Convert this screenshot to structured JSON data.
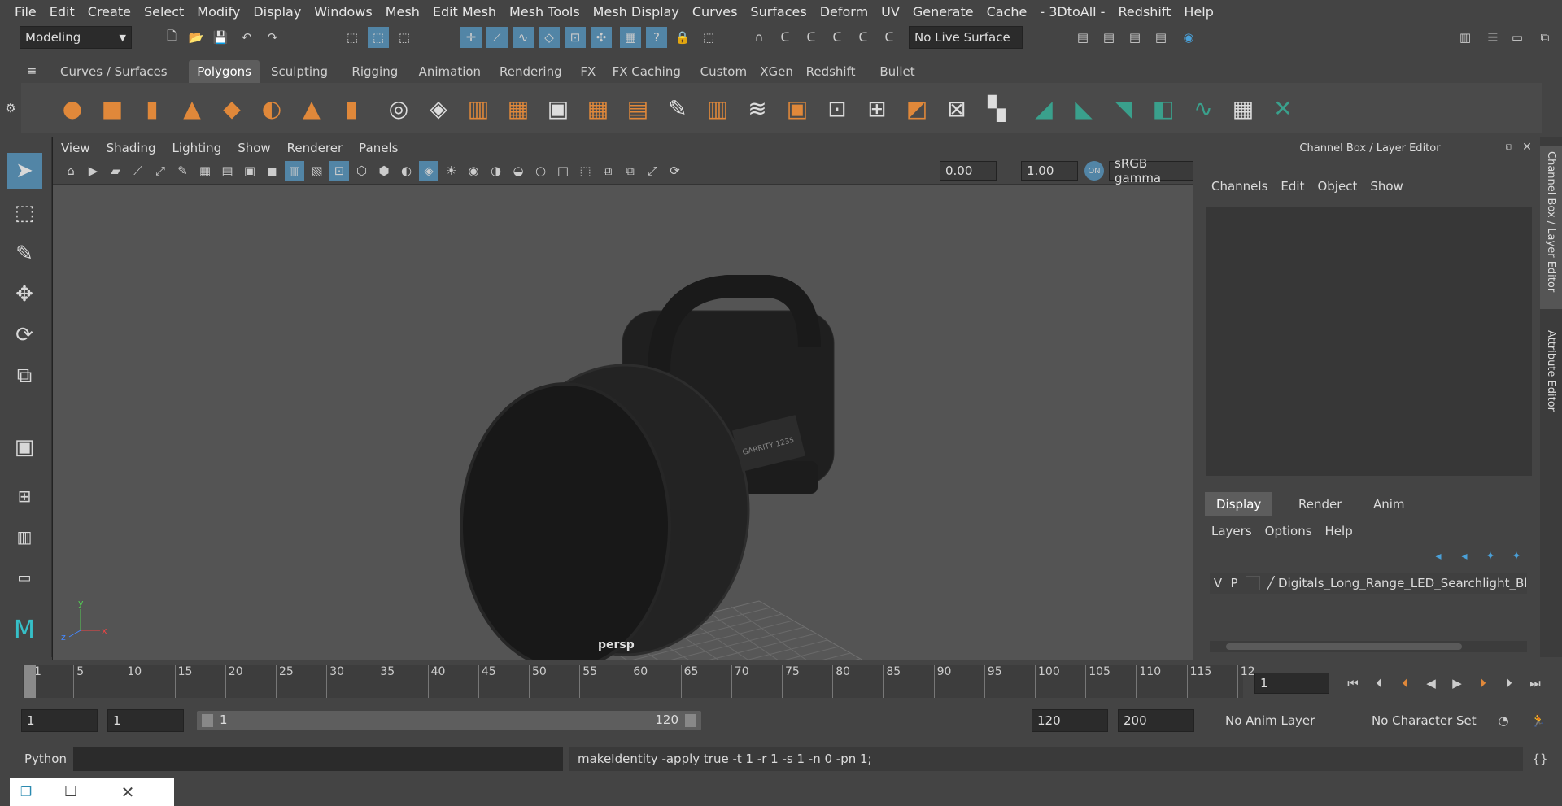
{
  "menu": [
    "File",
    "Edit",
    "Create",
    "Select",
    "Modify",
    "Display",
    "Windows",
    "Mesh",
    "Edit Mesh",
    "Mesh Tools",
    "Mesh Display",
    "Curves",
    "Surfaces",
    "Deform",
    "UV",
    "Generate",
    "Cache",
    "- 3DtoAll -",
    "Redshift",
    "Help"
  ],
  "status": {
    "mode": "Modeling",
    "live_surface": "No Live Surface"
  },
  "shelf_tabs": [
    "Curves / Surfaces",
    "Polygons",
    "Sculpting",
    "Rigging",
    "Animation",
    "Rendering",
    "FX",
    "FX Caching",
    "Custom",
    "XGen",
    "Redshift",
    "Bullet"
  ],
  "shelf_active": "Polygons",
  "viewport": {
    "menu": [
      "View",
      "Shading",
      "Lighting",
      "Show",
      "Renderer",
      "Panels"
    ],
    "exposure": "0.00",
    "gamma": "1.00",
    "color_space": "sRGB gamma",
    "camera_label": "persp",
    "plate": "GARRITY 1235"
  },
  "channel_box": {
    "title": "Channel Box / Layer Editor",
    "menu": [
      "Channels",
      "Edit",
      "Object",
      "Show"
    ],
    "layer_tabs": [
      "Display",
      "Render",
      "Anim"
    ],
    "layer_menu": [
      "Layers",
      "Options",
      "Help"
    ],
    "layer": {
      "v": "V",
      "p": "P",
      "name": "Digitals_Long_Range_LED_Searchlight_Bl"
    }
  },
  "side_tabs": [
    "Channel Box / Layer Editor",
    "Attribute Editor"
  ],
  "timeline": {
    "ticks": [
      "1",
      "5",
      "10",
      "15",
      "20",
      "25",
      "30",
      "35",
      "40",
      "45",
      "50",
      "55",
      "60",
      "65",
      "70",
      "75",
      "80",
      "85",
      "90",
      "95",
      "100",
      "105",
      "110",
      "115",
      "12"
    ],
    "current_frame": "1"
  },
  "range": {
    "start": "1",
    "play_start": "1",
    "slider_start": "1",
    "slider_end": "120",
    "play_end": "120",
    "end": "200",
    "anim_layer": "No Anim Layer",
    "char_set": "No Character Set"
  },
  "command": {
    "lang": "Python",
    "output": "makeIdentity -apply true -t 1 -r 1 -s 1 -n 0 -pn 1;"
  },
  "colors": {
    "active_blue": "#5285a6",
    "shelf_orange": "#e0883a",
    "shelf_teal": "#3aa08c"
  }
}
